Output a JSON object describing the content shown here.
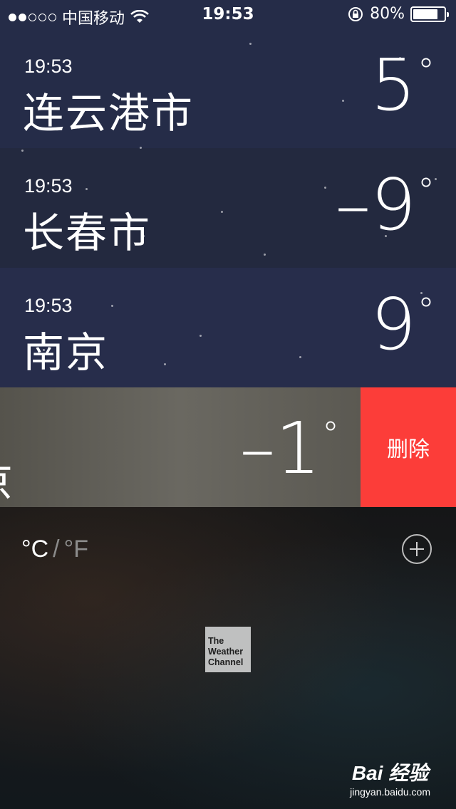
{
  "status_bar": {
    "signal_bars": 2,
    "signal_total": 5,
    "carrier": "中国移动",
    "time": "19:53",
    "battery_text": "80%",
    "battery_level": 0.8
  },
  "cities": [
    {
      "time": "19:53",
      "name": "连云港市",
      "temp": "5",
      "deg": "°",
      "bg": "#252c48"
    },
    {
      "time": "19:53",
      "name": "长春市",
      "temp": "–9",
      "deg": "°",
      "bg": "#23293f"
    },
    {
      "time": "19:53",
      "name": "南京",
      "temp": "9",
      "deg": "°",
      "bg": "#272d4b"
    }
  ],
  "swiped_row": {
    "city_partial": "京",
    "temp": "–1",
    "deg": "°",
    "delete_label": "删除",
    "delete_color": "#fc3d39"
  },
  "footer": {
    "unit_c": "°C",
    "unit_sep": "/",
    "unit_f": "°F",
    "weather_channel_line1": "The",
    "weather_channel_line2": "Weather",
    "weather_channel_line3": "Channel",
    "watermark_logo": "Bai  经验",
    "watermark_url": "jingyan.baidu.com"
  }
}
